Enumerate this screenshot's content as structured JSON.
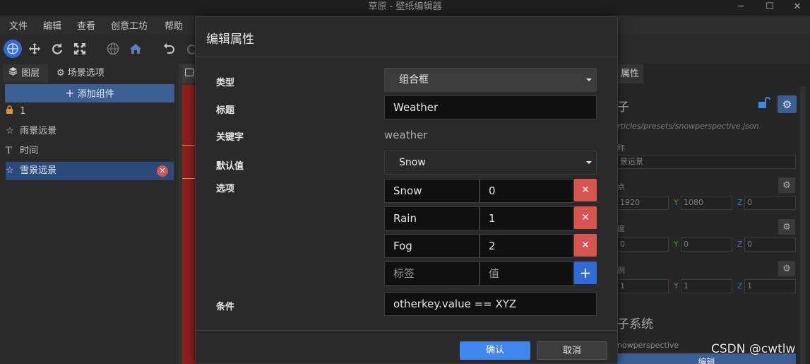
{
  "window": {
    "title": "草原 - 壁纸编辑器"
  },
  "menu": {
    "items": [
      "文件",
      "编辑",
      "查看",
      "创意工坊",
      "帮助"
    ]
  },
  "left_panel": {
    "tabs": [
      "图层",
      "场景选项"
    ],
    "add_button": "添加组件",
    "items": [
      {
        "label": "1",
        "icon": "lock-icon"
      },
      {
        "label": "雨景远景",
        "icon": "star-icon"
      },
      {
        "label": "时间",
        "icon": "text-icon"
      },
      {
        "label": "雪景远景",
        "icon": "star-icon",
        "selected": true
      }
    ]
  },
  "right_panel": {
    "tab": "属性",
    "heading": "子",
    "path": "rticles/presets/snowperspective.json",
    "name_label": "称",
    "name_value": "景远景",
    "origin_label": "点",
    "origin": {
      "x": "1920",
      "y": "1080",
      "z": "0"
    },
    "angles_label": "度",
    "angles": {
      "x": "0",
      "y": "0",
      "z": "0"
    },
    "scale_label": "例",
    "scale": {
      "x": "1",
      "y": "1",
      "z": "1"
    },
    "particle_heading": "子系统",
    "particle_name": "nowperspective",
    "edit_button": "编辑",
    "axis_labels": [
      "Y",
      "Z"
    ]
  },
  "modal": {
    "title": "编辑属性",
    "type_label": "类型",
    "type_value": "组合框",
    "title_label": "标题",
    "title_value": "Weather",
    "key_label": "关键字",
    "key_value": "weather",
    "default_label": "默认值",
    "default_value": "Snow",
    "options_label": "选项",
    "options": [
      {
        "label": "Snow",
        "value": "0"
      },
      {
        "label": "Rain",
        "value": "1"
      },
      {
        "label": "Fog",
        "value": "2"
      }
    ],
    "new_option": {
      "label_placeholder": "标签",
      "value_placeholder": "值"
    },
    "condition_label": "条件",
    "condition_value": "otherkey.value == XYZ",
    "confirm": "确认",
    "cancel": "取消"
  },
  "watermark": "CSDN @cwtlw",
  "colors": {
    "accent": "#3f86ee",
    "danger": "#d9534f",
    "selection": "#2c4b7a"
  }
}
